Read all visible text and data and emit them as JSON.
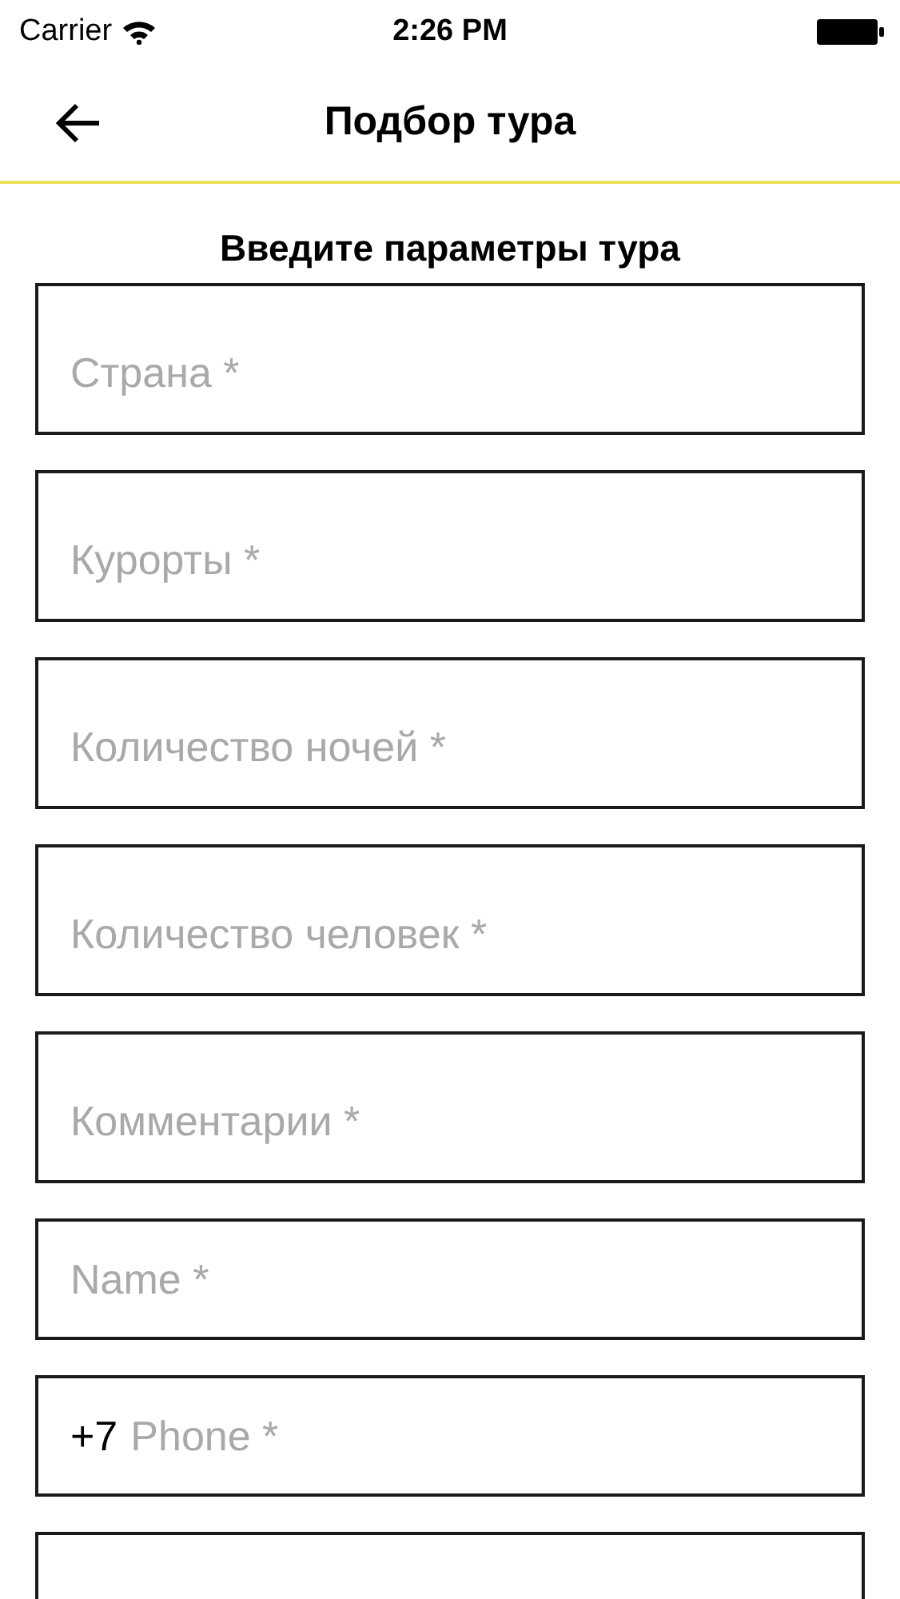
{
  "status_bar": {
    "carrier": "Carrier",
    "time": "2:26 PM"
  },
  "nav_bar": {
    "title": "Подбор тура"
  },
  "heading": "Введите параметры тура",
  "fields": [
    {
      "kind": "tall",
      "placeholder": "Страна *"
    },
    {
      "kind": "tall",
      "placeholder": "Курорты *"
    },
    {
      "kind": "tall",
      "placeholder": "Количество ночей *"
    },
    {
      "kind": "tall",
      "placeholder": "Количество человек *"
    },
    {
      "kind": "tall",
      "placeholder": "Комментарии *"
    },
    {
      "kind": "short",
      "placeholder": "Name *"
    },
    {
      "kind": "short",
      "prefix": "+7",
      "placeholder": "Phone *"
    },
    {
      "kind": "cut"
    }
  ]
}
